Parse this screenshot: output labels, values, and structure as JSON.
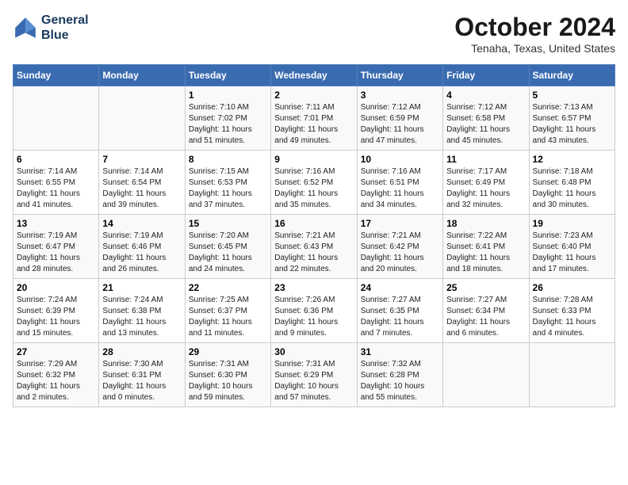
{
  "header": {
    "logo_line1": "General",
    "logo_line2": "Blue",
    "month_title": "October 2024",
    "location": "Tenaha, Texas, United States"
  },
  "days_of_week": [
    "Sunday",
    "Monday",
    "Tuesday",
    "Wednesday",
    "Thursday",
    "Friday",
    "Saturday"
  ],
  "weeks": [
    [
      {
        "day": "",
        "info": ""
      },
      {
        "day": "",
        "info": ""
      },
      {
        "day": "1",
        "info": "Sunrise: 7:10 AM\nSunset: 7:02 PM\nDaylight: 11 hours\nand 51 minutes."
      },
      {
        "day": "2",
        "info": "Sunrise: 7:11 AM\nSunset: 7:01 PM\nDaylight: 11 hours\nand 49 minutes."
      },
      {
        "day": "3",
        "info": "Sunrise: 7:12 AM\nSunset: 6:59 PM\nDaylight: 11 hours\nand 47 minutes."
      },
      {
        "day": "4",
        "info": "Sunrise: 7:12 AM\nSunset: 6:58 PM\nDaylight: 11 hours\nand 45 minutes."
      },
      {
        "day": "5",
        "info": "Sunrise: 7:13 AM\nSunset: 6:57 PM\nDaylight: 11 hours\nand 43 minutes."
      }
    ],
    [
      {
        "day": "6",
        "info": "Sunrise: 7:14 AM\nSunset: 6:55 PM\nDaylight: 11 hours\nand 41 minutes."
      },
      {
        "day": "7",
        "info": "Sunrise: 7:14 AM\nSunset: 6:54 PM\nDaylight: 11 hours\nand 39 minutes."
      },
      {
        "day": "8",
        "info": "Sunrise: 7:15 AM\nSunset: 6:53 PM\nDaylight: 11 hours\nand 37 minutes."
      },
      {
        "day": "9",
        "info": "Sunrise: 7:16 AM\nSunset: 6:52 PM\nDaylight: 11 hours\nand 35 minutes."
      },
      {
        "day": "10",
        "info": "Sunrise: 7:16 AM\nSunset: 6:51 PM\nDaylight: 11 hours\nand 34 minutes."
      },
      {
        "day": "11",
        "info": "Sunrise: 7:17 AM\nSunset: 6:49 PM\nDaylight: 11 hours\nand 32 minutes."
      },
      {
        "day": "12",
        "info": "Sunrise: 7:18 AM\nSunset: 6:48 PM\nDaylight: 11 hours\nand 30 minutes."
      }
    ],
    [
      {
        "day": "13",
        "info": "Sunrise: 7:19 AM\nSunset: 6:47 PM\nDaylight: 11 hours\nand 28 minutes."
      },
      {
        "day": "14",
        "info": "Sunrise: 7:19 AM\nSunset: 6:46 PM\nDaylight: 11 hours\nand 26 minutes."
      },
      {
        "day": "15",
        "info": "Sunrise: 7:20 AM\nSunset: 6:45 PM\nDaylight: 11 hours\nand 24 minutes."
      },
      {
        "day": "16",
        "info": "Sunrise: 7:21 AM\nSunset: 6:43 PM\nDaylight: 11 hours\nand 22 minutes."
      },
      {
        "day": "17",
        "info": "Sunrise: 7:21 AM\nSunset: 6:42 PM\nDaylight: 11 hours\nand 20 minutes."
      },
      {
        "day": "18",
        "info": "Sunrise: 7:22 AM\nSunset: 6:41 PM\nDaylight: 11 hours\nand 18 minutes."
      },
      {
        "day": "19",
        "info": "Sunrise: 7:23 AM\nSunset: 6:40 PM\nDaylight: 11 hours\nand 17 minutes."
      }
    ],
    [
      {
        "day": "20",
        "info": "Sunrise: 7:24 AM\nSunset: 6:39 PM\nDaylight: 11 hours\nand 15 minutes."
      },
      {
        "day": "21",
        "info": "Sunrise: 7:24 AM\nSunset: 6:38 PM\nDaylight: 11 hours\nand 13 minutes."
      },
      {
        "day": "22",
        "info": "Sunrise: 7:25 AM\nSunset: 6:37 PM\nDaylight: 11 hours\nand 11 minutes."
      },
      {
        "day": "23",
        "info": "Sunrise: 7:26 AM\nSunset: 6:36 PM\nDaylight: 11 hours\nand 9 minutes."
      },
      {
        "day": "24",
        "info": "Sunrise: 7:27 AM\nSunset: 6:35 PM\nDaylight: 11 hours\nand 7 minutes."
      },
      {
        "day": "25",
        "info": "Sunrise: 7:27 AM\nSunset: 6:34 PM\nDaylight: 11 hours\nand 6 minutes."
      },
      {
        "day": "26",
        "info": "Sunrise: 7:28 AM\nSunset: 6:33 PM\nDaylight: 11 hours\nand 4 minutes."
      }
    ],
    [
      {
        "day": "27",
        "info": "Sunrise: 7:29 AM\nSunset: 6:32 PM\nDaylight: 11 hours\nand 2 minutes."
      },
      {
        "day": "28",
        "info": "Sunrise: 7:30 AM\nSunset: 6:31 PM\nDaylight: 11 hours\nand 0 minutes."
      },
      {
        "day": "29",
        "info": "Sunrise: 7:31 AM\nSunset: 6:30 PM\nDaylight: 10 hours\nand 59 minutes."
      },
      {
        "day": "30",
        "info": "Sunrise: 7:31 AM\nSunset: 6:29 PM\nDaylight: 10 hours\nand 57 minutes."
      },
      {
        "day": "31",
        "info": "Sunrise: 7:32 AM\nSunset: 6:28 PM\nDaylight: 10 hours\nand 55 minutes."
      },
      {
        "day": "",
        "info": ""
      },
      {
        "day": "",
        "info": ""
      }
    ]
  ]
}
